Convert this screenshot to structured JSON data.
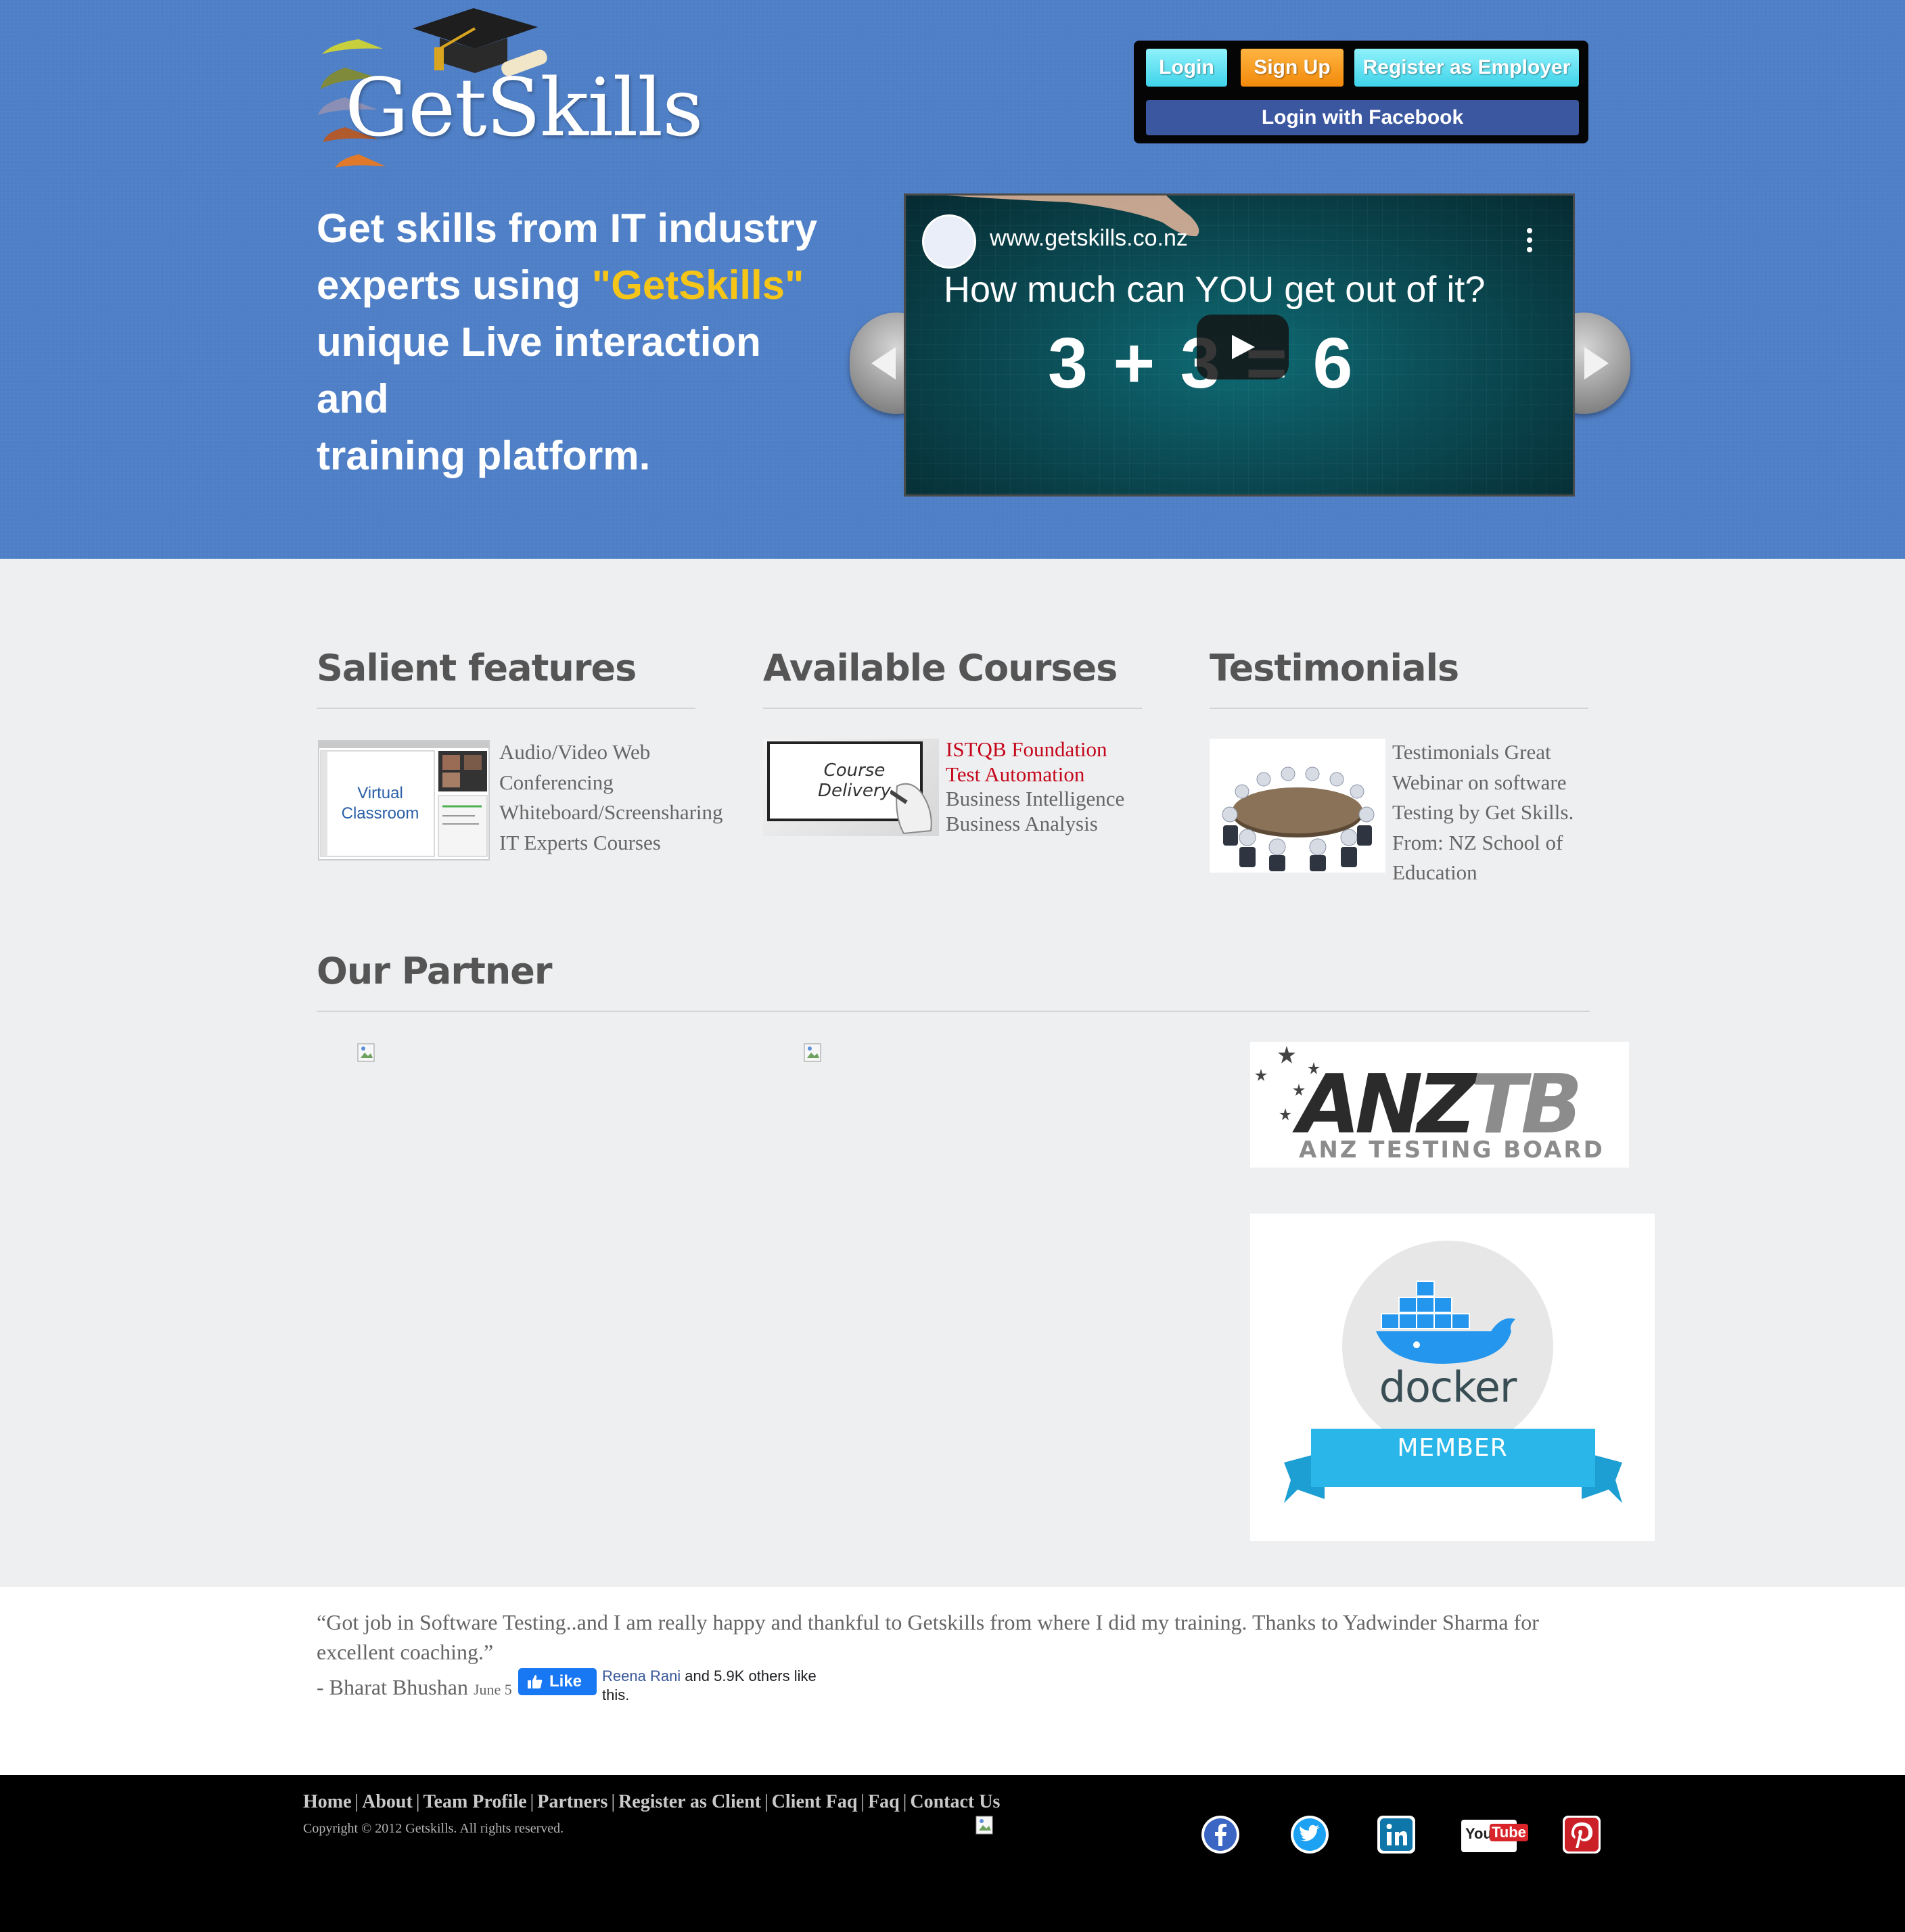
{
  "header": {
    "logo_text": "GetSkills",
    "auth": {
      "login": "Login",
      "signup": "Sign Up",
      "register_employer": "Register as Employer",
      "facebook_login": "Login with Facebook"
    },
    "hero": {
      "line1": "Get skills from IT industry",
      "line2_prefix": "experts using ",
      "line2_highlight": "\"GetSkills\"",
      "line3": "unique Live interaction and",
      "line4": "training platform."
    },
    "video": {
      "channel_url": "www.getskills.co.nz",
      "question": "How much can YOU get out of it?",
      "equation": "3 + 3 = 6"
    }
  },
  "sections": {
    "salient": {
      "heading": "Salient features",
      "thumb_label_1": "Virtual",
      "thumb_label_2": "Classroom",
      "items": [
        "Audio/Video Web",
        "Conferencing",
        "Whiteboard/Screensharing",
        "IT Experts Courses"
      ]
    },
    "courses": {
      "heading": "Available Courses",
      "thumb_text_1": "Course",
      "thumb_text_2": "Delivery",
      "links": [
        "ISTQB Foundation",
        "Test Automation"
      ],
      "items": [
        "Business Intelligence",
        "Business Analysis"
      ]
    },
    "testimonials": {
      "heading": "Testimonials",
      "lines": [
        "Testimonials Great",
        "Webinar on software",
        "Testing by Get Skills.",
        "From: NZ School of",
        "Education"
      ]
    },
    "partner": {
      "heading": "Our Partner",
      "anztb_anz": "ANZ",
      "anztb_tb": "TB",
      "anztb_sub": "ANZ TESTING BOARD",
      "docker_word": "docker",
      "docker_member": "MEMBER"
    }
  },
  "quote": {
    "text": "“Got job in Software Testing..and I am really happy and thankful to Getskills from where I did my training. Thanks to Yadwinder Sharma for excellent coaching.”",
    "author": "- Bharat Bhushan",
    "date": "June 5",
    "like_label": "Like",
    "like_name": "Reena Rani",
    "like_rest": " and 5.9K others like this."
  },
  "footer": {
    "nav": [
      "Home",
      "About",
      "Team Profile",
      "Partners",
      "Register as Client",
      "Client Faq",
      "Faq",
      "Contact Us"
    ],
    "copyright": "Copyright © 2012 Getskills. All rights reserved.",
    "social_icons": [
      "facebook-icon",
      "twitter-icon",
      "linkedin-icon",
      "youtube-icon",
      "pinterest-icon"
    ],
    "youtube_you": "You",
    "youtube_tube": "Tube"
  },
  "colors": {
    "header_bg": "#4f7fc6",
    "hero_highlight": "#f5c518",
    "course_link": "#c4071b",
    "signup": "#f28a0b",
    "login": "#3fd3ea",
    "facebook": "#3b57a0",
    "docker_blue": "#2ab6e8"
  }
}
